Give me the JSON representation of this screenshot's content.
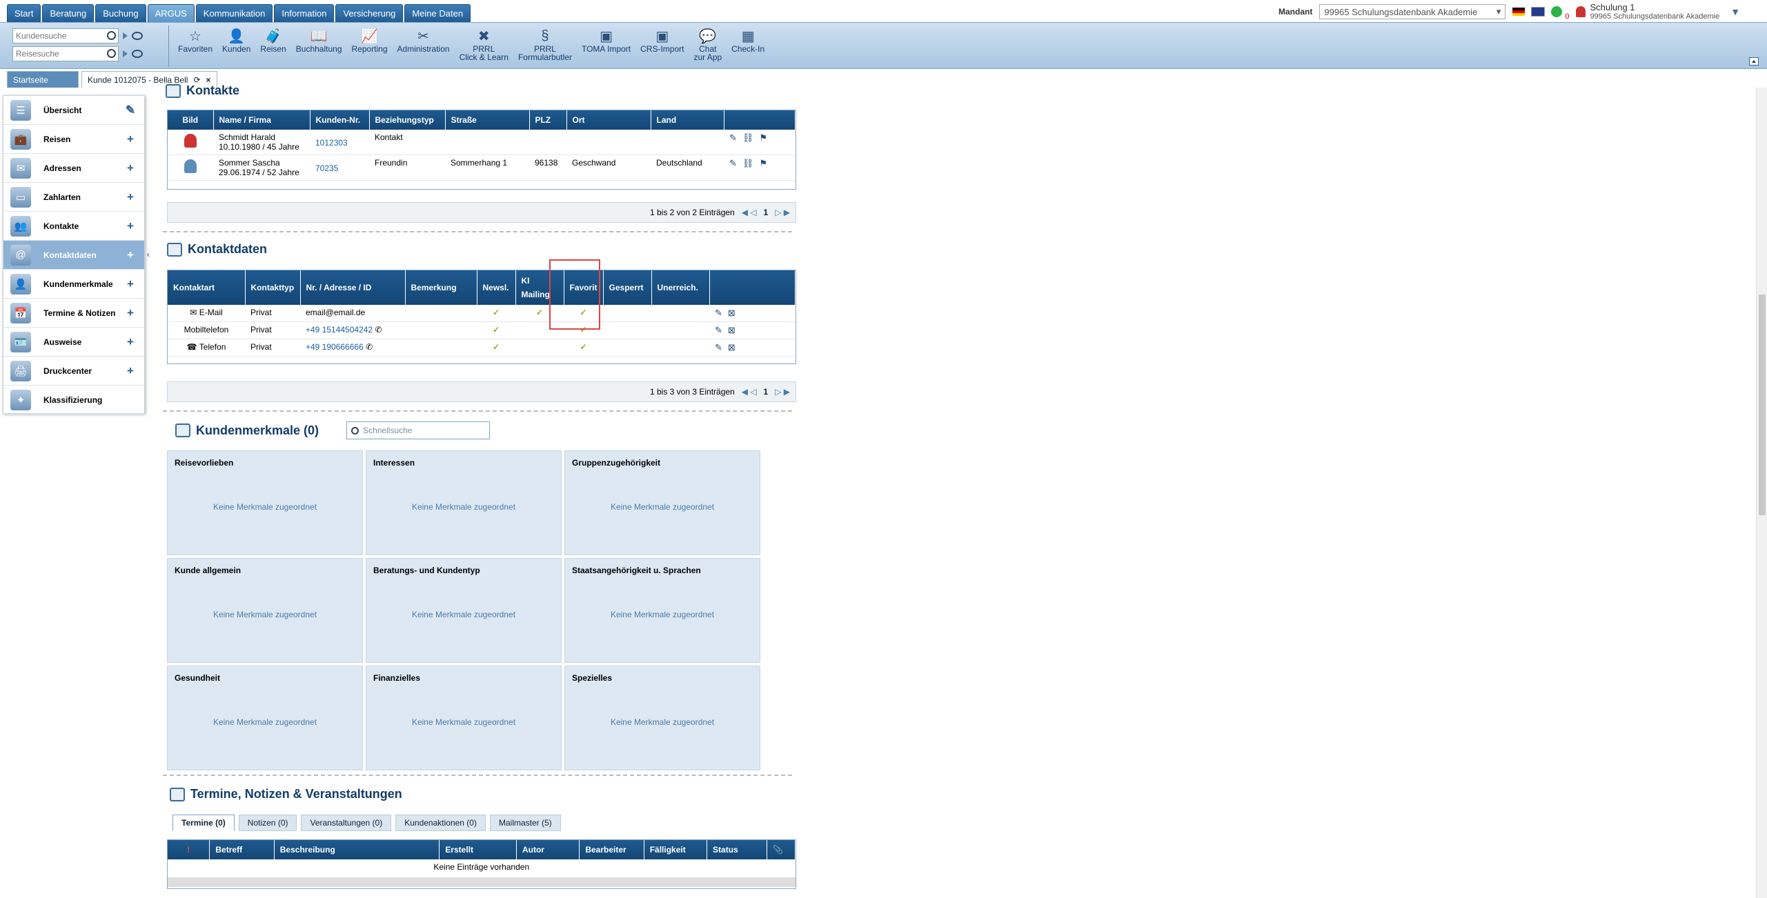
{
  "topmenu": [
    "Start",
    "Beratung",
    "Buchung",
    "ARGUS",
    "Kommunikation",
    "Information",
    "Versicherung",
    "Meine Daten"
  ],
  "topmenu_active": "ARGUS",
  "header": {
    "mandant_label": "Mandant",
    "mandant_value": "99965 Schulungsdatenbank Akademie",
    "notify_count": "0",
    "user_name": "Schulung 1",
    "user_org": "99965 Schulungsdatenbank Akademie"
  },
  "search": {
    "customer_placeholder": "Kundensuche",
    "travel_placeholder": "Reisesuche"
  },
  "toolbar": [
    {
      "label": "Favoriten",
      "icon": "star-icon"
    },
    {
      "label": "Kunden",
      "icon": "customer-icon"
    },
    {
      "label": "Reisen",
      "icon": "suitcase-icon"
    },
    {
      "label": "Buchhaltung",
      "icon": "book-icon"
    },
    {
      "label": "Reporting",
      "icon": "report-icon"
    },
    {
      "label": "Administration",
      "icon": "tools-icon"
    },
    {
      "label": "PRRL\nClick & Learn",
      "icon": "learn-icon"
    },
    {
      "label": "PRRL\nFormularbutler",
      "icon": "paragraph-icon"
    },
    {
      "label": "TOMA Import",
      "icon": "toma-icon"
    },
    {
      "label": "CRS-Import",
      "icon": "crs-icon"
    },
    {
      "label": "Chat\nzur App",
      "icon": "chat-icon"
    },
    {
      "label": "Check-In",
      "icon": "qr-icon"
    }
  ],
  "open_tabs": {
    "home": "Startseite",
    "customer": "Kunde 1012075 - Bella Bell"
  },
  "sidenav": [
    {
      "label": "Übersicht",
      "action": "✎",
      "icon": "overview-icon"
    },
    {
      "label": "Reisen",
      "action": "+",
      "icon": "suitcase-icon"
    },
    {
      "label": "Adressen",
      "action": "+",
      "icon": "address-icon"
    },
    {
      "label": "Zahlarten",
      "action": "+",
      "icon": "card-icon"
    },
    {
      "label": "Kontakte",
      "action": "+",
      "icon": "contacts-icon"
    },
    {
      "label": "Kontaktdaten",
      "action": "+",
      "icon": "at-icon"
    },
    {
      "label": "Kundenmerkmale",
      "action": "+",
      "icon": "person-icon"
    },
    {
      "label": "Termine & Notizen",
      "action": "+",
      "icon": "calendar-icon"
    },
    {
      "label": "Ausweise",
      "action": "+",
      "icon": "id-card-icon"
    },
    {
      "label": "Druckcenter",
      "action": "+",
      "icon": "printer-icon"
    },
    {
      "label": "Klassifizierung",
      "action": "",
      "icon": "compass-icon"
    }
  ],
  "sidenav_active": "Kontaktdaten",
  "kontakte": {
    "title": "Kontakte",
    "columns": [
      "Bild",
      "Name / Firma",
      "Kunden-Nr.",
      "Beziehungstyp",
      "Straße",
      "PLZ",
      "Ort",
      "Land"
    ],
    "rows": [
      {
        "name": "Schmidt Harald",
        "sub": "10.10.1980 / 45 Jahre",
        "nr": "1012303",
        "typ": "Kontakt",
        "strasse": "",
        "plz": "",
        "ort": "",
        "land": "",
        "avatar_color": "#c33"
      },
      {
        "name": "Sommer Sascha",
        "sub": "29.06.1974 / 52 Jahre",
        "nr": "70235",
        "typ": "Freundin",
        "strasse": "Sommerhang 1",
        "plz": "96138",
        "ort": "Geschwand",
        "land": "Deutschland",
        "avatar_color": "#5c8cba"
      }
    ],
    "pager_text": "1 bis 2 von 2 Einträgen",
    "page": "1"
  },
  "kontaktdaten": {
    "title": "Kontaktdaten",
    "columns": [
      "Kontaktart",
      "Kontakttyp",
      "Nr. / Adresse / ID",
      "Bemerkung",
      "Newsl.",
      "KI\nMailing",
      "Favorit",
      "Gesperrt",
      "Unerreich."
    ],
    "rows": [
      {
        "art": "E-Mail",
        "art_icon": "✉",
        "typ": "Privat",
        "wert": "email@email.de",
        "phone": false,
        "newsl": "✓",
        "ki": "✓",
        "favorit": "✓"
      },
      {
        "art": "Mobiltelefon",
        "art_icon": "",
        "typ": "Privat",
        "wert": "+49 15144504242",
        "phone": true,
        "newsl": "✓",
        "ki": "",
        "favorit": "✓"
      },
      {
        "art": "Telefon",
        "art_icon": "☎",
        "typ": "Privat",
        "wert": "+49 190666666",
        "phone": true,
        "newsl": "✓",
        "ki": "",
        "favorit": "✓"
      }
    ],
    "pager_text": "1 bis 3 von 3 Einträgen",
    "page": "1"
  },
  "merkmale": {
    "title": "Kundenmerkmale (0)",
    "quicksearch_placeholder": "Schnellsuche",
    "empty_text": "Keine Merkmale zugeordnet",
    "cards": [
      "Reisevorlieben",
      "Interessen",
      "Gruppenzugehörigkeit",
      "Kunde allgemein",
      "Beratungs- und Kundentyp",
      "Staatsangehörigkeit u. Sprachen",
      "Gesundheit",
      "Finanzielles",
      "Spezielles"
    ]
  },
  "termine": {
    "title": "Termine, Notizen & Veranstaltungen",
    "tabs": [
      "Termine (0)",
      "Notizen (0)",
      "Veranstaltungen (0)",
      "Kundenaktionen (0)",
      "Mailmaster (5)"
    ],
    "columns": [
      "!",
      "Betreff",
      "Beschreibung",
      "Erstellt",
      "Autor",
      "Bearbeiter",
      "Fälligkeit",
      "Status",
      "📎"
    ],
    "empty": "Keine Einträge vorhanden"
  }
}
